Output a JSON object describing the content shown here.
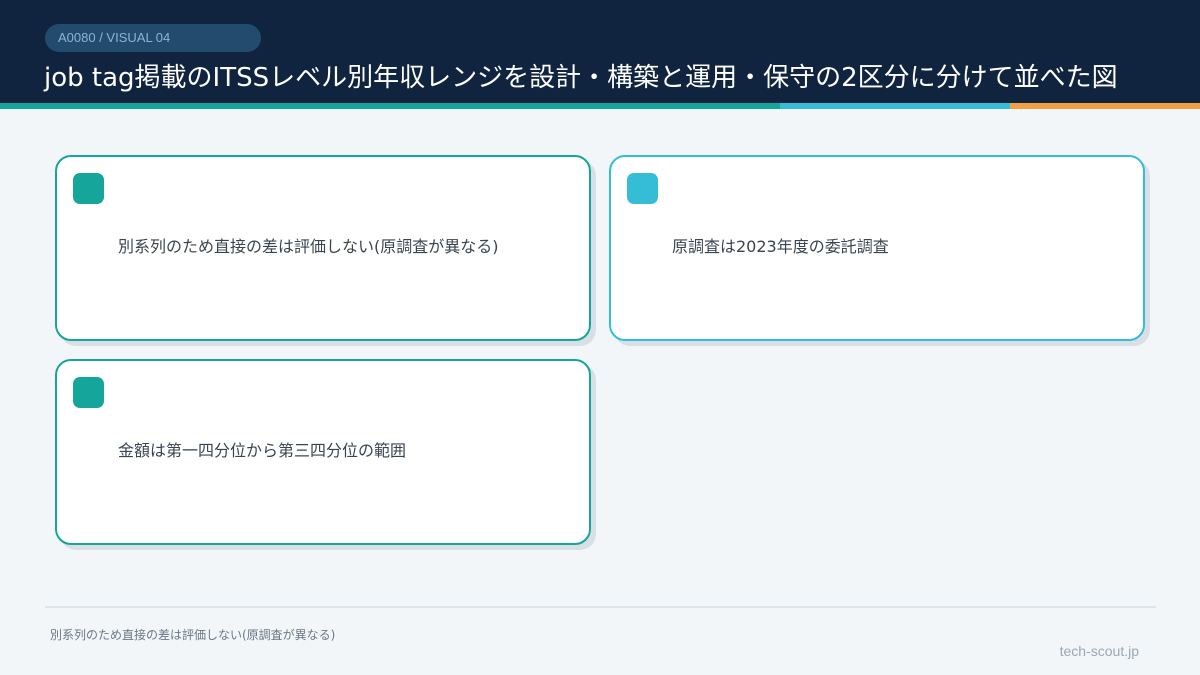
{
  "header": {
    "tag": "A0080 / VISUAL 04",
    "title": "job tag掲載のITSSレベル別年収レンジを設計・構築と運用・保守の2区分に分けて並べた図"
  },
  "colors": {
    "header_bg": "#10243f",
    "teal": "#15a59b",
    "cyan": "#35bcd6",
    "orange": "#f0a142",
    "page_bg": "#f2f6f9"
  },
  "cards": [
    {
      "text": "別系列のため直接の差は評価しない(原調査が異なる)",
      "accent": "teal"
    },
    {
      "text": "原調査は2023年度の委託調査",
      "accent": "cyan"
    },
    {
      "text": "金額は第一四分位から第三四分位の範囲",
      "accent": "teal"
    }
  ],
  "footer": {
    "note": "別系列のため直接の差は評価しない(原調査が異なる)",
    "brand": "tech-scout.jp"
  }
}
